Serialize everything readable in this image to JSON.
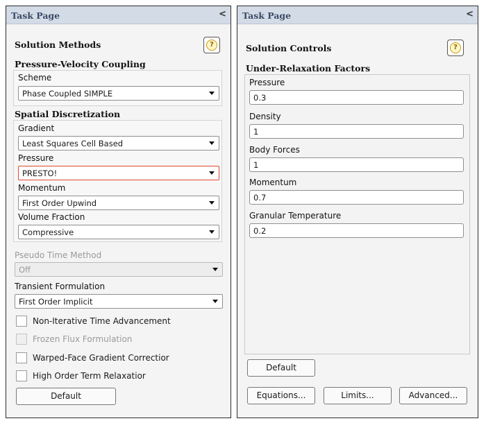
{
  "left": {
    "header": "Task Page",
    "collapse_glyph": "<",
    "section_title": "Solution Methods",
    "help_glyph": "?",
    "pv_coupling": {
      "title": "Pressure-Velocity Coupling",
      "scheme_label": "Scheme",
      "scheme_value": "Phase Coupled SIMPLE"
    },
    "spatial": {
      "title": "Spatial Discretization",
      "gradient_label": "Gradient",
      "gradient_value": "Least Squares Cell Based",
      "pressure_label": "Pressure",
      "pressure_value": "PRESTO!",
      "momentum_label": "Momentum",
      "momentum_value": "First Order Upwind",
      "volume_fraction_label": "Volume Fraction",
      "volume_fraction_value": "Compressive"
    },
    "pseudo_time_label": "Pseudo Time Method",
    "pseudo_time_value": "Off",
    "transient_label": "Transient Formulation",
    "transient_value": "First Order Implicit",
    "checkboxes": [
      {
        "label": "Non-Iterative Time Advancement",
        "checked": false,
        "enabled": true
      },
      {
        "label": "Frozen Flux Formulation",
        "checked": false,
        "enabled": false
      },
      {
        "label": "Warped-Face Gradient Correctior",
        "checked": false,
        "enabled": true
      },
      {
        "label": "High Order Term Relaxatior",
        "checked": false,
        "enabled": true
      }
    ],
    "default_button": "Default"
  },
  "right": {
    "header": "Task Page",
    "collapse_glyph": "<",
    "section_title": "Solution Controls",
    "help_glyph": "?",
    "urf_title": "Under-Relaxation Factors",
    "factors": [
      {
        "label": "Pressure",
        "value": "0.3"
      },
      {
        "label": "Density",
        "value": "1"
      },
      {
        "label": "Body Forces",
        "value": "1"
      },
      {
        "label": "Momentum",
        "value": "0.7"
      },
      {
        "label": "Granular Temperature",
        "value": "0.2"
      }
    ],
    "default_button": "Default",
    "equations_button": "Equations...",
    "limits_button": "Limits...",
    "advanced_button": "Advanced..."
  },
  "colors": {
    "header_bg": "#d3dbe6",
    "highlight_border": "#e0472e",
    "help_icon": "#c79a17"
  }
}
